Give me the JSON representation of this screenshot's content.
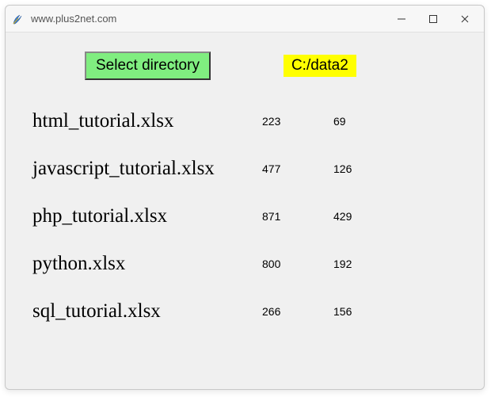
{
  "window": {
    "title": "www.plus2net.com"
  },
  "toolbar": {
    "select_button_label": "Select directory",
    "selected_path": "C:/data2"
  },
  "files": [
    {
      "name": "html_tutorial.xlsx",
      "col1": "223",
      "col2": "69"
    },
    {
      "name": "javascript_tutorial.xlsx",
      "col1": "477",
      "col2": "126"
    },
    {
      "name": "php_tutorial.xlsx",
      "col1": "871",
      "col2": "429"
    },
    {
      "name": "python.xlsx",
      "col1": "800",
      "col2": "192"
    },
    {
      "name": "sql_tutorial.xlsx",
      "col1": "266",
      "col2": "156"
    }
  ]
}
